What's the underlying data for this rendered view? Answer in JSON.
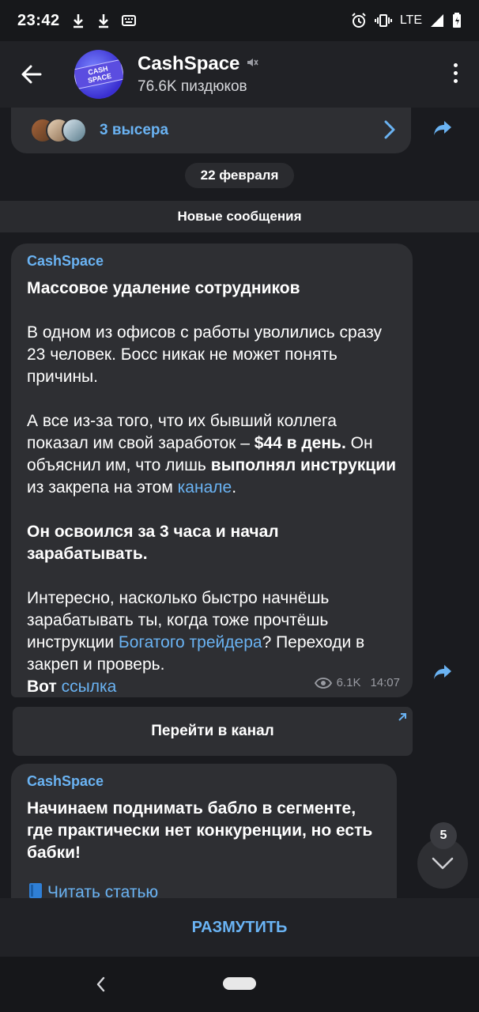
{
  "status_bar": {
    "time": "23:42",
    "network": "LTE"
  },
  "header": {
    "title": "CashSpace",
    "subtitle": "76.6K пиздюков",
    "avatar_text": "CASH SPACE"
  },
  "comments_bar": {
    "label": "3 высера"
  },
  "date_pill": "22 февраля",
  "new_messages_label": "Новые сообщения",
  "post": {
    "sender": "CashSpace",
    "headline": "Массовое удаление сотрудников",
    "p1": "В одном из офисов с работы уволились сразу 23 человек. Босс никак не может понять причины.",
    "p2_a": "А все из-за того, что их бывший коллега показал им свой заработок – ",
    "p2_bold1": "$44 в день.",
    "p2_b": " Он объяснил им, что лишь ",
    "p2_bold2": "выполнял инструкции",
    "p2_c": " из закрепа на этом ",
    "p2_link": "канале",
    "p2_d": ".",
    "p3_bold": "Он освоился за 3 часа и начал зарабатывать.",
    "p4_a": "Интересно, насколько быстро начнёшь зарабатывать ты, когда тоже прочтёшь инструкции ",
    "p4_link": "Богатого трейдера",
    "p4_b": "? Переходи в закреп и проверь.",
    "p5_bold": "Вот",
    "p5_link": "ссылка",
    "views": "6.1K",
    "time": "14:07"
  },
  "channel_button": {
    "label": "Перейти в канал"
  },
  "post2": {
    "sender": "CashSpace",
    "headline": "Начинаем поднимать бабло в сегменте, где практически нет конкуренции, но есть бабки!",
    "read_link": "Читать статью"
  },
  "scroll_fab": {
    "badge": "5"
  },
  "bottom_bar": {
    "label": "РАЗМУТИТЬ"
  },
  "colors": {
    "accent": "#6ab3f3",
    "bubble": "#2e2f33",
    "background": "#1a1b1f"
  }
}
